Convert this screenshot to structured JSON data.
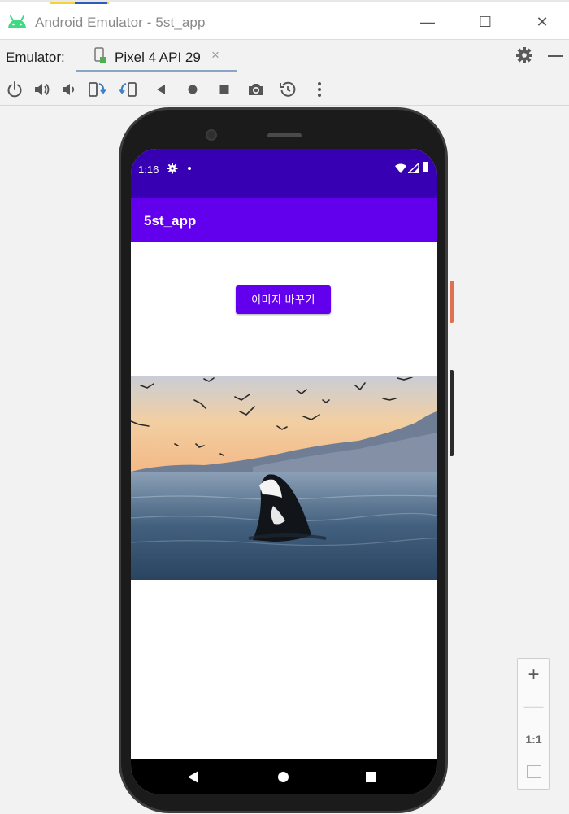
{
  "window": {
    "title": "Android Emulator - 5st_app",
    "minimize_glyph": "—",
    "maximize_glyph": "☐",
    "close_glyph": "✕"
  },
  "tabbar": {
    "label": "Emulator:",
    "tab_label": "Pixel 4 API 29",
    "tab_close": "×"
  },
  "toolbar": {
    "icons": [
      "power-icon",
      "volume-up-icon",
      "volume-down-icon",
      "rotate-left-icon",
      "rotate-right-icon",
      "back-icon",
      "home-icon",
      "overview-icon",
      "camera-icon",
      "replay-icon",
      "more-icon"
    ]
  },
  "device": {
    "status": {
      "time": "1:16"
    },
    "app_title": "5st_app",
    "button_label": "이미지 바꾸기",
    "image": "orca-whale-photo"
  },
  "zoom": {
    "plus": "+",
    "minus": "—",
    "one_to_one": "1:1"
  },
  "colors": {
    "status_bar": "#3700b3",
    "app_bar": "#6200ee",
    "button": "#6200ee"
  }
}
